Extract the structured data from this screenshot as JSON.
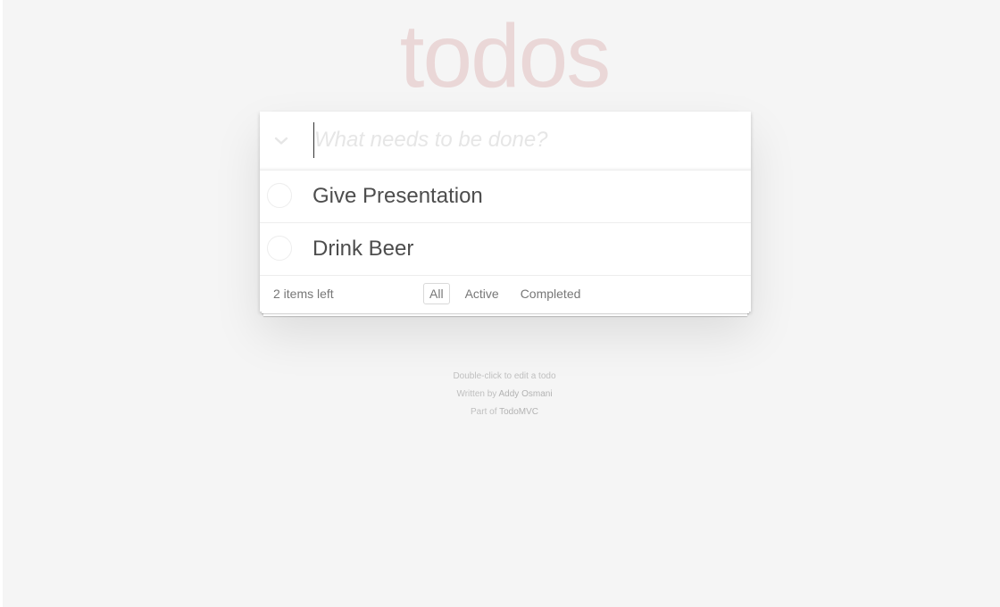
{
  "header": {
    "title": "todos",
    "new_todo_placeholder": "What needs to be done?"
  },
  "todos": [
    {
      "label": "Give Presentation",
      "completed": false
    },
    {
      "label": "Drink Beer",
      "completed": false
    }
  ],
  "footer": {
    "count_number": "2",
    "count_suffix": " items left",
    "filters": [
      {
        "label": "All",
        "selected": true
      },
      {
        "label": "Active",
        "selected": false
      },
      {
        "label": "Completed",
        "selected": false
      }
    ]
  },
  "info": {
    "edit_hint": "Double-click to edit a todo",
    "written_by_prefix": "Written by ",
    "author": "Addy Osmani",
    "part_of_prefix": "Part of ",
    "project": "TodoMVC"
  },
  "icons": {
    "toggle_all": "chevron-down-icon"
  },
  "colors": {
    "title": "#efd6d6",
    "background": "#f5f5f5",
    "text": "#4d4d4d"
  }
}
